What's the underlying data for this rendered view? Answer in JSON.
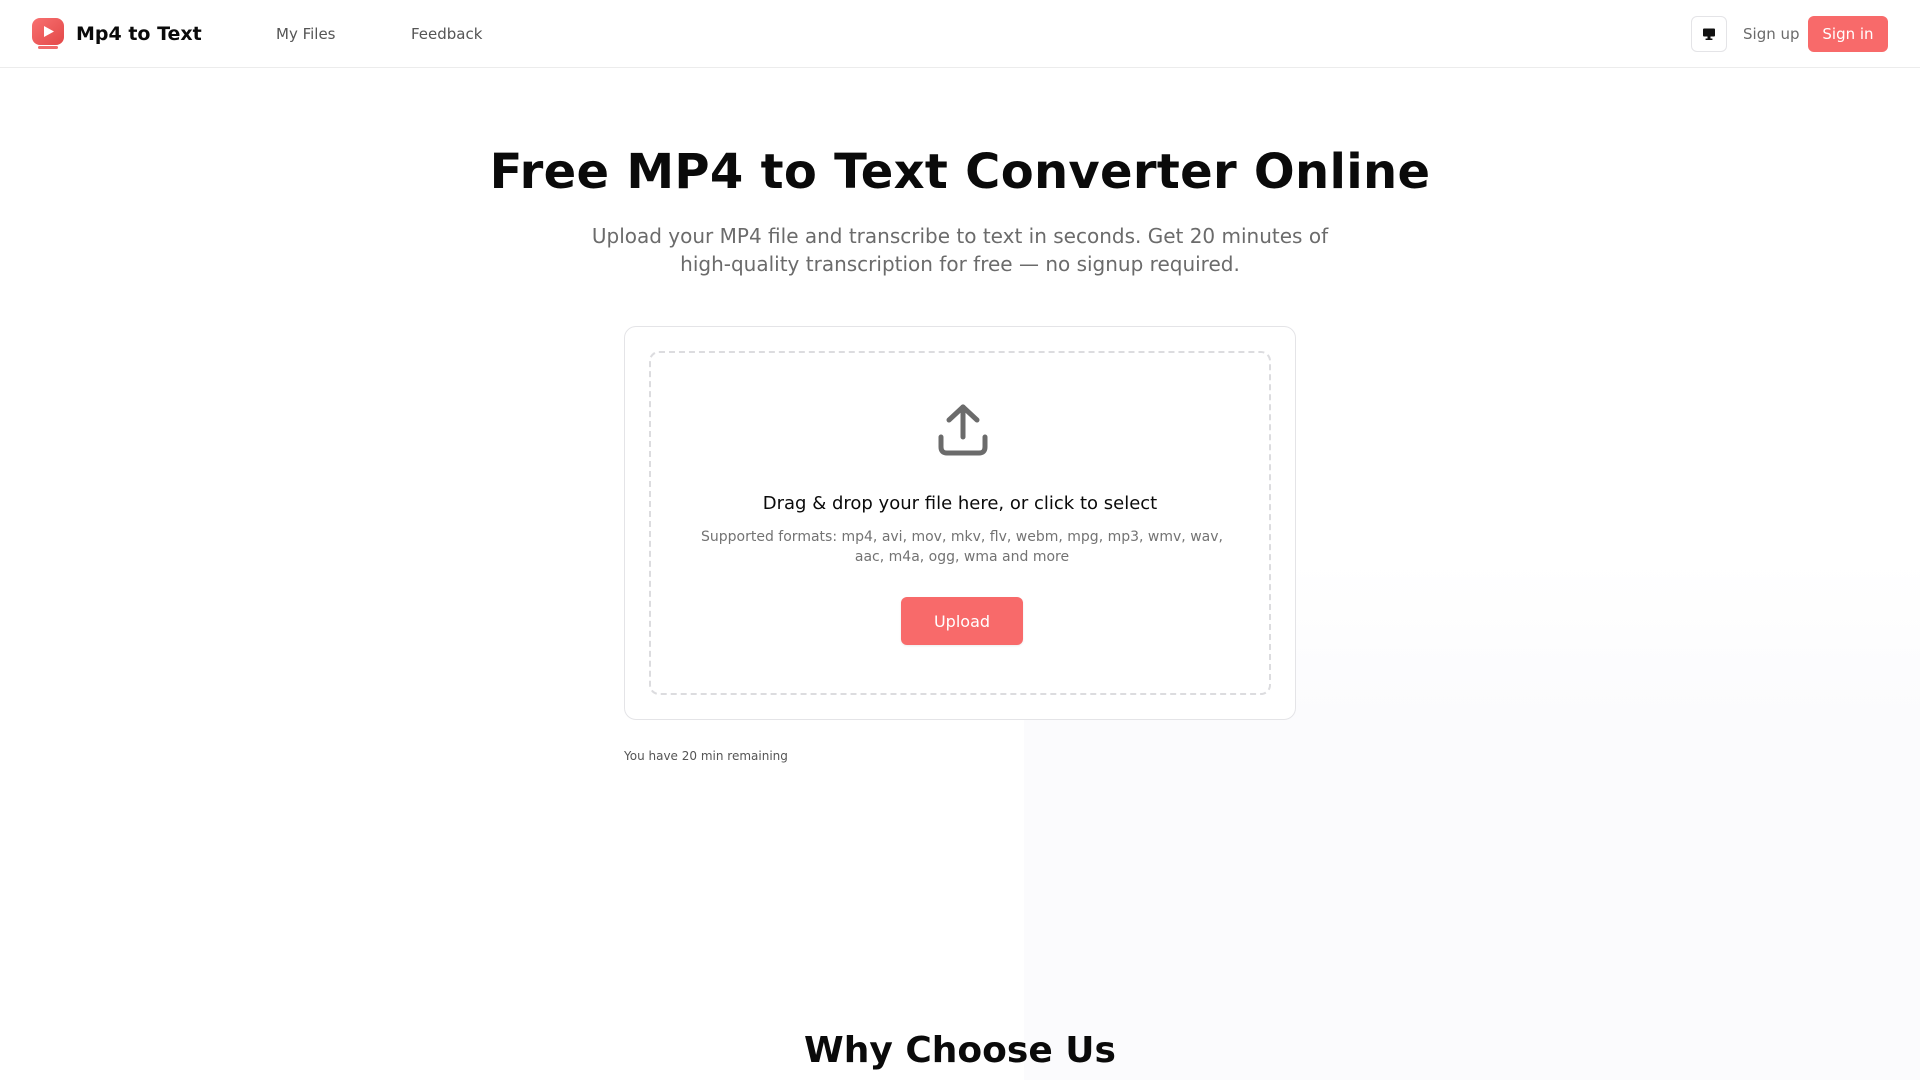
{
  "header": {
    "brand": "Mp4 to Text",
    "nav": [
      {
        "label": "My Files"
      },
      {
        "label": "Feedback"
      }
    ],
    "theme_icon": "monitor-icon",
    "signup_label": "Sign up",
    "signin_label": "Sign in"
  },
  "hero": {
    "title": "Free MP4 to Text Converter Online",
    "subtitle": "Upload your MP4 file and transcribe to text in seconds. Get 20 minutes of high-quality transcription for free — no signup required."
  },
  "uploader": {
    "icon": "upload-icon",
    "drop_title": "Drag & drop your file here, or click to select",
    "formats": "Supported formats: mp4, avi, mov, mkv, flv, webm, mpg, mp3, wmv, wav, aac, m4a, ogg, wma and more",
    "button_label": "Upload",
    "remaining": "You have 20 min remaining"
  },
  "features": {
    "title": "Why Choose Us"
  },
  "colors": {
    "accent": "#f86a6a",
    "text": "#0a0a0a",
    "muted": "#6b6b6b",
    "border": "#e4e4e7"
  }
}
